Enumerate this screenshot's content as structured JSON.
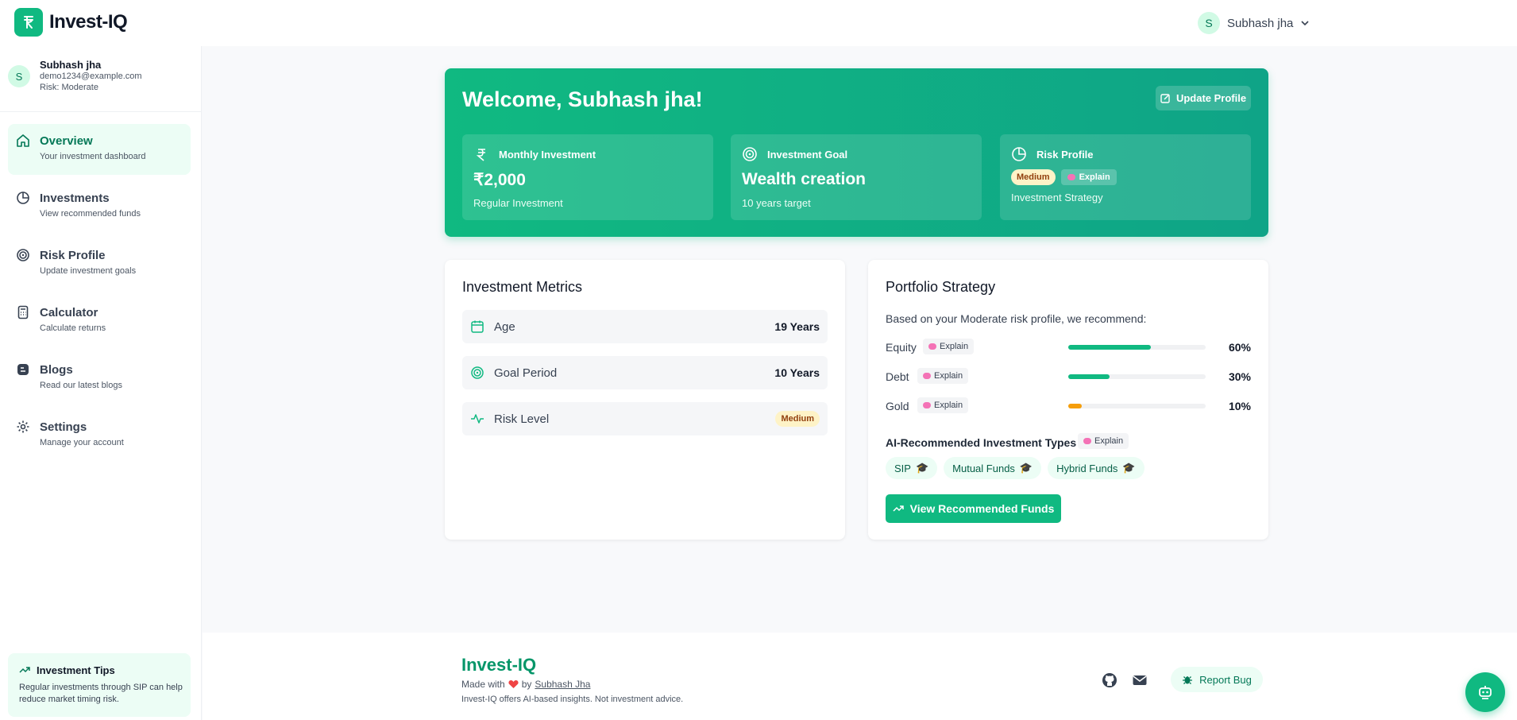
{
  "app": {
    "name": "Invest-IQ"
  },
  "header": {
    "user_initial": "S",
    "user_name": "Subhash jha"
  },
  "sidebar": {
    "profile": {
      "initial": "S",
      "name": "Subhash jha",
      "email": "demo1234@example.com",
      "risk": "Risk: Moderate"
    },
    "items": [
      {
        "label": "Overview",
        "sub": "Your investment dashboard",
        "icon": "home-icon",
        "active": true
      },
      {
        "label": "Investments",
        "sub": "View recommended funds",
        "icon": "pie-chart-icon"
      },
      {
        "label": "Risk Profile",
        "sub": "Update investment goals",
        "icon": "target-icon"
      },
      {
        "label": "Calculator",
        "sub": "Calculate returns",
        "icon": "calculator-icon"
      },
      {
        "label": "Blogs",
        "sub": "Read our latest blogs",
        "icon": "blog-icon"
      },
      {
        "label": "Settings",
        "sub": "Manage your account",
        "icon": "gear-icon"
      }
    ],
    "tips": {
      "title": "Investment Tips",
      "text": "Regular investments through SIP can help reduce market timing risk."
    }
  },
  "hero": {
    "title": "Welcome, Subhash jha!",
    "update_button": "Update Profile",
    "cards": [
      {
        "label": "Monthly Investment",
        "value": "₹2,000",
        "sub": "Regular Investment"
      },
      {
        "label": "Investment Goal",
        "value": "Wealth creation",
        "sub": "10 years target"
      },
      {
        "label": "Risk Profile",
        "badge": "Medium",
        "explain": "Explain",
        "sub": "Investment Strategy"
      }
    ]
  },
  "metrics": {
    "title": "Investment Metrics",
    "rows": [
      {
        "label": "Age",
        "value": "19 Years"
      },
      {
        "label": "Goal Period",
        "value": "10 Years"
      },
      {
        "label": "Risk Level",
        "badge": "Medium"
      }
    ]
  },
  "strategy": {
    "title": "Portfolio Strategy",
    "subtitle": "Based on your Moderate risk profile, we recommend:",
    "explain_label": "Explain",
    "allocations": [
      {
        "name": "Equity",
        "pct_text": "60%",
        "pct": 60,
        "color": "#10b981"
      },
      {
        "name": "Debt",
        "pct_text": "30%",
        "pct": 30,
        "color": "#10b981"
      },
      {
        "name": "Gold",
        "pct_text": "10%",
        "pct": 10,
        "color": "#f59e0b"
      }
    ],
    "ai_title": "AI-Recommended Investment Types",
    "types": [
      "SIP",
      "Mutual Funds",
      "Hybrid Funds"
    ],
    "cta": "View Recommended Funds"
  },
  "footer": {
    "brand": "Invest-IQ",
    "made_with": "Made with",
    "by": "by",
    "author": "Subhash Jha",
    "note": "Invest-IQ offers AI-based insights. Not investment advice.",
    "report_bug": "Report Bug"
  },
  "colors": {
    "accent": "#10b981",
    "accent_dark": "#059669",
    "badge_bg": "#fef3c7"
  }
}
